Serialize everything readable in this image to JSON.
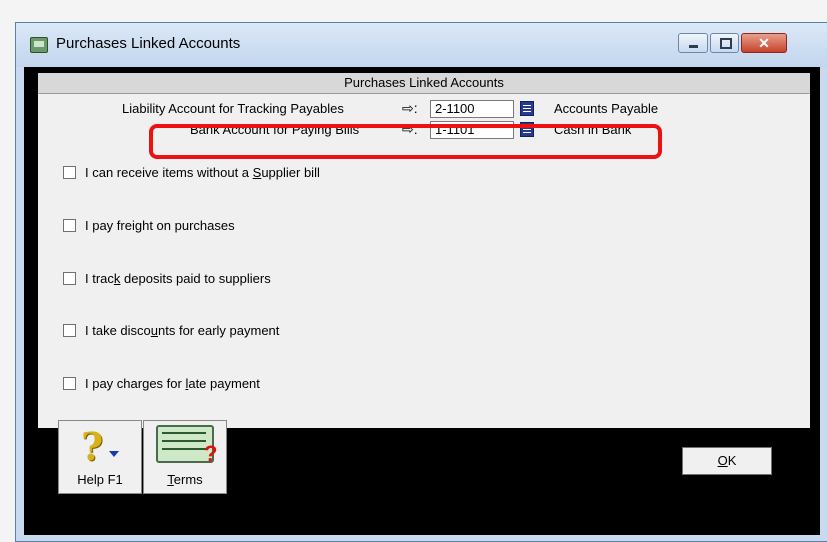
{
  "window": {
    "title": "Purchases Linked Accounts"
  },
  "panel": {
    "header": "Purchases Linked Accounts"
  },
  "liability": {
    "label": "Liability Account for Tracking Payables",
    "arrow": "⇨:",
    "account": "2-1100",
    "account_name": "Accounts Payable"
  },
  "bank": {
    "label": "Bank Account for Paying Bills",
    "arrow": "⇨:",
    "account": "1-1101",
    "account_name": "Cash in Bank"
  },
  "options": [
    {
      "pre": "I can receive items without a ",
      "u": "S",
      "post": "upplier bill",
      "checked": false
    },
    {
      "pre": "I pay freight on purchases",
      "u": "",
      "post": "",
      "checked": false
    },
    {
      "pre": "I trac",
      "u": "k",
      "post": " deposits paid to suppliers",
      "checked": false
    },
    {
      "pre": "I take disco",
      "u": "u",
      "post": "nts for early payment",
      "checked": false
    },
    {
      "pre": "I pay charges for ",
      "u": "l",
      "post": "ate payment",
      "checked": false
    }
  ],
  "buttons": {
    "help": "Help F1",
    "terms_u": "T",
    "terms_rest": "erms",
    "ok_u": "O",
    "ok_rest": "K",
    "close_glyph": "✕"
  },
  "colors": {
    "highlight": "#ee1111",
    "lookup": "#283a8f"
  }
}
